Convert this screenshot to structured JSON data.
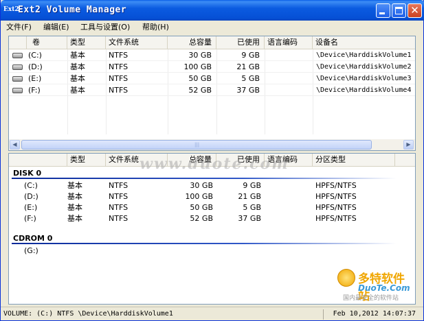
{
  "window": {
    "title": "Ext2 Volume Manager",
    "icon_text": "Ext2"
  },
  "menu": [
    "文件(F)",
    "编辑(E)",
    "工具与设置(O)",
    "帮助(H)"
  ],
  "volumes_table": {
    "columns": [
      "卷",
      "类型",
      "文件系统",
      "总容量",
      "已使用",
      "语言编码",
      "设备名"
    ],
    "rows": [
      {
        "volume": "(C:)",
        "type": "基本",
        "fs": "NTFS",
        "total": "30 GB",
        "used": "9 GB",
        "codepage": "",
        "device": "\\Device\\HarddiskVolume1"
      },
      {
        "volume": "(D:)",
        "type": "基本",
        "fs": "NTFS",
        "total": "100 GB",
        "used": "21 GB",
        "codepage": "",
        "device": "\\Device\\HarddiskVolume2"
      },
      {
        "volume": "(E:)",
        "type": "基本",
        "fs": "NTFS",
        "total": "50 GB",
        "used": "5 GB",
        "codepage": "",
        "device": "\\Device\\HarddiskVolume3"
      },
      {
        "volume": "(F:)",
        "type": "基本",
        "fs": "NTFS",
        "total": "52 GB",
        "used": "37 GB",
        "codepage": "",
        "device": "\\Device\\HarddiskVolume4"
      }
    ]
  },
  "disks_table": {
    "columns": [
      "",
      "类型",
      "文件系统",
      "总容量",
      "已使用",
      "语言编码",
      "分区类型"
    ],
    "watermark": "www.duote.com",
    "groups": [
      {
        "title": "DISK 0",
        "rows": [
          {
            "volume": "(C:)",
            "type": "基本",
            "fs": "NTFS",
            "total": "30 GB",
            "used": "9 GB",
            "part": "HPFS/NTFS"
          },
          {
            "volume": "(D:)",
            "type": "基本",
            "fs": "NTFS",
            "total": "100 GB",
            "used": "21 GB",
            "part": "HPFS/NTFS"
          },
          {
            "volume": "(E:)",
            "type": "基本",
            "fs": "NTFS",
            "total": "50 GB",
            "used": "5 GB",
            "part": "HPFS/NTFS"
          },
          {
            "volume": "(F:)",
            "type": "基本",
            "fs": "NTFS",
            "total": "52 GB",
            "used": "37 GB",
            "part": "HPFS/NTFS"
          }
        ]
      },
      {
        "title": "CDROM 0",
        "rows": [
          {
            "volume": "(G:)",
            "type": "",
            "fs": "",
            "total": "",
            "used": "",
            "part": ""
          }
        ]
      }
    ]
  },
  "logo": {
    "cn": "多特软件站",
    "en": "DuoTe.Com",
    "sub": "国内最安全的软件站"
  },
  "status": {
    "left": "VOLUME:  (C:) NTFS \\Device\\HarddiskVolume1",
    "right": "Feb 10,2012 14:07:37"
  },
  "colors": {
    "titlebar": "#0a5fe8",
    "close_button": "#c9411f",
    "group_line": "#0a2a9a"
  }
}
